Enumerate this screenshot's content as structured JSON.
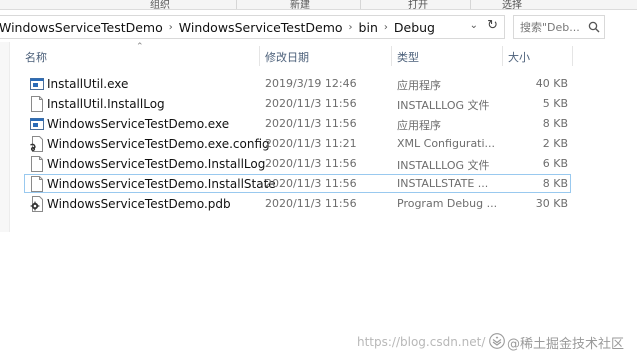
{
  "ribbon": {
    "groups": [
      "组织",
      "新建",
      "打开",
      "选择"
    ]
  },
  "address": {
    "crumbs": [
      "WindowsServiceTestDemo",
      "WindowsServiceTestDemo",
      "bin",
      "Debug"
    ],
    "separator": "›",
    "dropdown_icon": "chevron-down-icon",
    "refresh_icon": "refresh-icon"
  },
  "search": {
    "placeholder": "搜索\"Deb...",
    "icon": "search-icon"
  },
  "columns": {
    "name": "名称",
    "date": "修改日期",
    "type": "类型",
    "size": "大小"
  },
  "files": [
    {
      "name": "InstallUtil.exe",
      "date": "2019/3/19 12:46",
      "type": "应用程序",
      "size": "40 KB",
      "icon": "exe-icon"
    },
    {
      "name": "InstallUtil.InstallLog",
      "date": "2020/11/3 11:56",
      "type": "INSTALLLOG 文件",
      "size": "5 KB",
      "icon": "document-icon"
    },
    {
      "name": "WindowsServiceTestDemo.exe",
      "date": "2020/11/3 11:56",
      "type": "应用程序",
      "size": "8 KB",
      "icon": "exe-icon"
    },
    {
      "name": "WindowsServiceTestDemo.exe.config",
      "date": "2020/11/3 11:21",
      "type": "XML Configurati...",
      "size": "2 KB",
      "icon": "config-icon"
    },
    {
      "name": "WindowsServiceTestDemo.InstallLog",
      "date": "2020/11/3 11:56",
      "type": "INSTALLLOG 文件",
      "size": "6 KB",
      "icon": "document-icon"
    },
    {
      "name": "WindowsServiceTestDemo.InstallState",
      "date": "2020/11/3 11:56",
      "type": "INSTALLSTATE ...",
      "size": "8 KB",
      "icon": "document-icon"
    },
    {
      "name": "WindowsServiceTestDemo.pdb",
      "date": "2020/11/3 11:56",
      "type": "Program Debug ...",
      "size": "30 KB",
      "icon": "pdb-icon"
    }
  ],
  "watermark": {
    "url": "https://blog.csdn.net/",
    "brand": "@稀土掘金技术社区"
  },
  "colors": {
    "header_text": "#4c607a",
    "focus_border": "#99c9ef",
    "exe_blue": "#2b6cb8"
  }
}
